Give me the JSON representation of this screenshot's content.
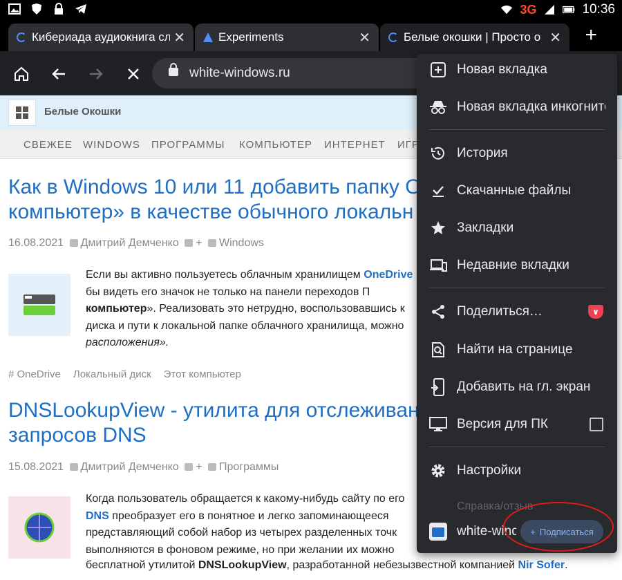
{
  "status_bar": {
    "network": "3G",
    "time": "10:36"
  },
  "tabs": [
    {
      "title": "Кибериада аудиокнига слушать",
      "icon": "loading-spinner-icon"
    },
    {
      "title": "Experiments",
      "icon": "flask-icon"
    },
    {
      "title": "Белые окошки | Просто о компьютере",
      "icon": "loading-spinner-icon"
    }
  ],
  "toolbar": {
    "url": "white-windows.ru"
  },
  "site": {
    "name": "Белые Окошки",
    "nav": [
      "СВЕЖЕЕ",
      "WINDOWS",
      "ПРОГРАММЫ",
      "КОМПЬЮТЕР",
      "ИНТЕРНЕТ",
      "ИГР"
    ]
  },
  "articles": [
    {
      "title_line1": "Как в Windows 10 или 11 добавить папку O",
      "title_line2": "компьютер» в качестве обычного локальн",
      "date": "16.08.2021",
      "author": "Дмитрий Демченко",
      "comments": "+",
      "category": "Windows",
      "excerpt_1a": "Если вы активно пользуетесь облачным хранилищем ",
      "excerpt_1link": "OneDrive",
      "excerpt_2": "бы видеть его значок не только на панели переходов П",
      "excerpt_3b": "компьютер",
      "excerpt_3": "». Реализовать это нетрудно, воспользовавшись к",
      "excerpt_4": "диска и пути к локальной папке облачного хранилища, можно",
      "excerpt_5": "расположения».",
      "tags": [
        "# OneDrive",
        "Локальный диск",
        "Этот компьютер"
      ]
    },
    {
      "title_line1": "DNSLookupView - утилита для отслеживан",
      "title_line2": "запросов DNS",
      "date": "15.08.2021",
      "author": "Дмитрий Демченко",
      "comments": "+",
      "category": "Программы",
      "excerpt_1": "Когда пользователь обращается к какому-нибудь сайту по его",
      "excerpt_2link": "DNS",
      "excerpt_2": " преобразует его в понятное и легко запоминающееся",
      "excerpt_3": "представляющий собой набор из четырех разделенных точк",
      "excerpt_4": "выполняются в фоновом режиме, но при желании их можно",
      "excerpt_5a": "бесплатной утилитой ",
      "excerpt_5b": "DNSLookupView",
      "excerpt_5c": ", разработанной небезызвестной компанией ",
      "excerpt_5link": "Nir Sofer",
      "excerpt_5d": "."
    }
  ],
  "menu": {
    "items": [
      {
        "label": "Новая вкладка",
        "icon": "plus-box-icon"
      },
      {
        "label": "Новая вкладка инкогнито",
        "icon": "incognito-icon"
      },
      {
        "label": "История",
        "icon": "history-icon"
      },
      {
        "label": "Скачанные файлы",
        "icon": "download-check-icon"
      },
      {
        "label": "Закладки",
        "icon": "star-icon"
      },
      {
        "label": "Недавние вкладки",
        "icon": "devices-icon"
      },
      {
        "label": "Поделиться…",
        "icon": "share-icon"
      },
      {
        "label": "Найти на странице",
        "icon": "find-in-page-icon"
      },
      {
        "label": "Добавить на гл. экран",
        "icon": "add-to-home-icon"
      },
      {
        "label": "Версия для ПК",
        "icon": "desktop-icon"
      },
      {
        "label": "Настройки",
        "icon": "gear-icon"
      }
    ],
    "faded_label": "Справка/отзыв",
    "footer": {
      "site": "white-windows.ru",
      "subscribe_label": "Подписаться"
    }
  },
  "colors": {
    "accent": "#1f6fc5",
    "menu_bg": "#292a2d",
    "annotation": "#e21b1b"
  }
}
